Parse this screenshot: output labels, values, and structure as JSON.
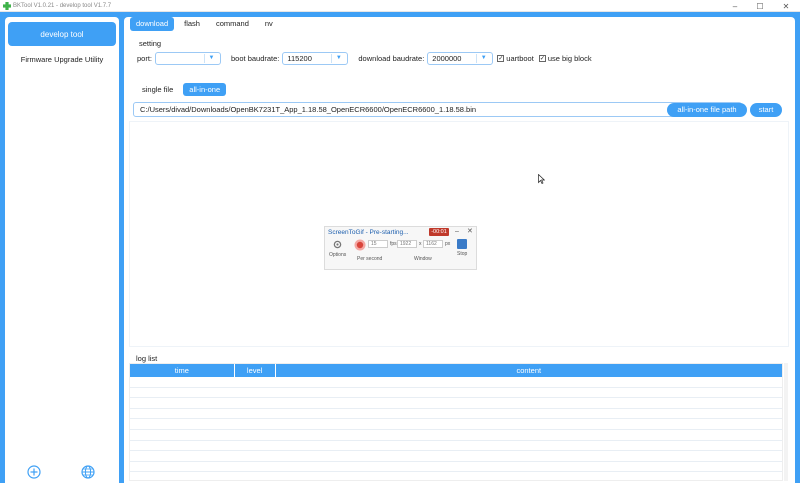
{
  "window": {
    "title": "BKTool V1.0.21 - develop tool V1.7.7",
    "minimize_glyph": "–",
    "maximize_glyph": "☐",
    "close_glyph": "✕"
  },
  "sidebar": {
    "items": [
      {
        "label": "develop tool",
        "active": true
      },
      {
        "label": "Firmware Upgrade Utility",
        "active": false
      }
    ],
    "bottom_icons": [
      "add-circle-icon",
      "globe-icon"
    ]
  },
  "tabs": [
    {
      "label": "download",
      "active": true
    },
    {
      "label": "flash",
      "active": false
    },
    {
      "label": "command",
      "active": false
    },
    {
      "label": "nv",
      "active": false
    }
  ],
  "setting": {
    "title": "setting",
    "port_label": "port:",
    "port_value": "",
    "boot_baudrate_label": "boot baudrate:",
    "boot_baudrate_value": "115200",
    "download_baudrate_label": "download baudrate:",
    "download_baudrate_value": "2000000",
    "uartboot_label": "uartboot",
    "uartboot_checked": true,
    "use_big_block_label": "use big block",
    "use_big_block_checked": true,
    "check_glyph": "✓"
  },
  "subtabs": [
    {
      "label": "single file",
      "active": false
    },
    {
      "label": "all-in-one",
      "active": true
    }
  ],
  "file_path": "C:/Users/divad/Downloads/OpenBK7231T_App_1.18.58_OpenECR6600/OpenECR6600_1.18.58.bin",
  "buttons": {
    "file_path_button": "all-in-one file path",
    "start_button": "start"
  },
  "screentogif": {
    "title": "ScreenToGif - Pre-starting...",
    "timer": "-00:01",
    "options_label": "Options",
    "fps_value": "15",
    "fps_label": "fps",
    "width_value": "1922",
    "height_value": "1162",
    "px_label": "px",
    "times_glyph": "x",
    "per_second_label": "Per second",
    "window_label": "Window",
    "stop_label": "Stop",
    "minimize_glyph": "–",
    "close_glyph": "✕"
  },
  "log": {
    "title": "log list",
    "columns": [
      "time",
      "level",
      "content"
    ],
    "rows": 10
  },
  "colors": {
    "accent": "#3fa0f5",
    "timer_red": "#c0392b"
  }
}
